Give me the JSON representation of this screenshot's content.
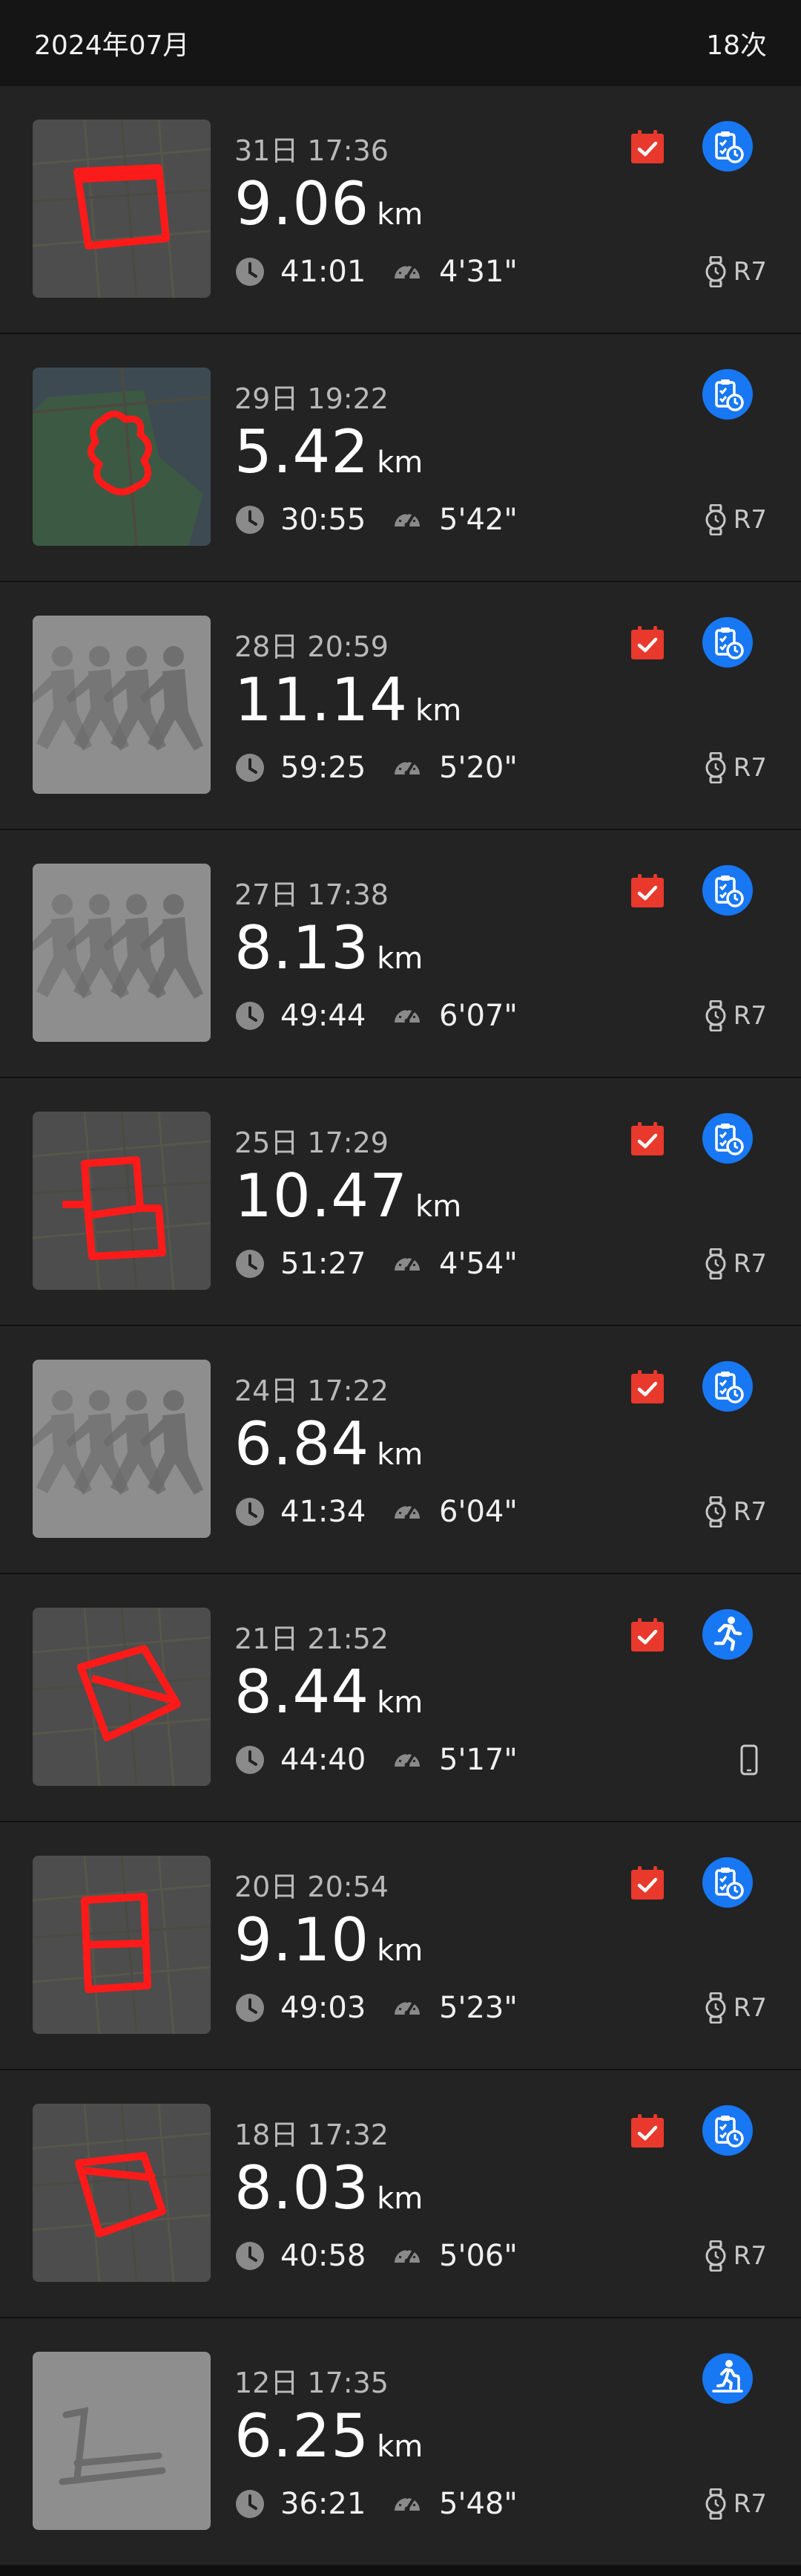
{
  "header": {
    "month": "2024年07月",
    "count": "18次"
  },
  "colors": {
    "accent_blue": "#1877f2",
    "checkin_red": "#e8392c",
    "route_red": "#ff1a1a",
    "row_bg": "#232323"
  },
  "unit": "km",
  "records": [
    {
      "date": "31日 17:36",
      "distance": "9.06",
      "duration": "41:01",
      "pace": "4'31\"",
      "device": "R7",
      "device_icon": "watch-icon",
      "type_icon": "clipboard-clock-icon",
      "checked_in": true,
      "thumb": "route-map"
    },
    {
      "date": "29日 19:22",
      "distance": "5.42",
      "duration": "30:55",
      "pace": "5'42\"",
      "device": "R7",
      "device_icon": "watch-icon",
      "type_icon": "clipboard-clock-icon",
      "checked_in": false,
      "thumb": "route-map-green"
    },
    {
      "date": "28日 20:59",
      "distance": "11.14",
      "duration": "59:25",
      "pace": "5'20\"",
      "device": "R7",
      "device_icon": "watch-icon",
      "type_icon": "clipboard-clock-icon",
      "checked_in": true,
      "thumb": "runners"
    },
    {
      "date": "27日 17:38",
      "distance": "8.13",
      "duration": "49:44",
      "pace": "6'07\"",
      "device": "R7",
      "device_icon": "watch-icon",
      "type_icon": "clipboard-clock-icon",
      "checked_in": true,
      "thumb": "runners"
    },
    {
      "date": "25日 17:29",
      "distance": "10.47",
      "duration": "51:27",
      "pace": "4'54\"",
      "device": "R7",
      "device_icon": "watch-icon",
      "type_icon": "clipboard-clock-icon",
      "checked_in": true,
      "thumb": "route-map"
    },
    {
      "date": "24日 17:22",
      "distance": "6.84",
      "duration": "41:34",
      "pace": "6'04\"",
      "device": "R7",
      "device_icon": "watch-icon",
      "type_icon": "clipboard-clock-icon",
      "checked_in": true,
      "thumb": "runners"
    },
    {
      "date": "21日 21:52",
      "distance": "8.44",
      "duration": "44:40",
      "pace": "5'17\"",
      "device": "",
      "device_icon": "phone-icon",
      "type_icon": "running-person-icon",
      "checked_in": true,
      "thumb": "route-map"
    },
    {
      "date": "20日 20:54",
      "distance": "9.10",
      "duration": "49:03",
      "pace": "5'23\"",
      "device": "R7",
      "device_icon": "watch-icon",
      "type_icon": "clipboard-clock-icon",
      "checked_in": true,
      "thumb": "route-map"
    },
    {
      "date": "18日 17:32",
      "distance": "8.03",
      "duration": "40:58",
      "pace": "5'06\"",
      "device": "R7",
      "device_icon": "watch-icon",
      "type_icon": "clipboard-clock-icon",
      "checked_in": true,
      "thumb": "route-map"
    },
    {
      "date": "12日 17:35",
      "distance": "6.25",
      "duration": "36:21",
      "pace": "5'48\"",
      "device": "R7",
      "device_icon": "watch-icon",
      "type_icon": "treadmill-person-icon",
      "checked_in": false,
      "thumb": "treadmill"
    }
  ]
}
